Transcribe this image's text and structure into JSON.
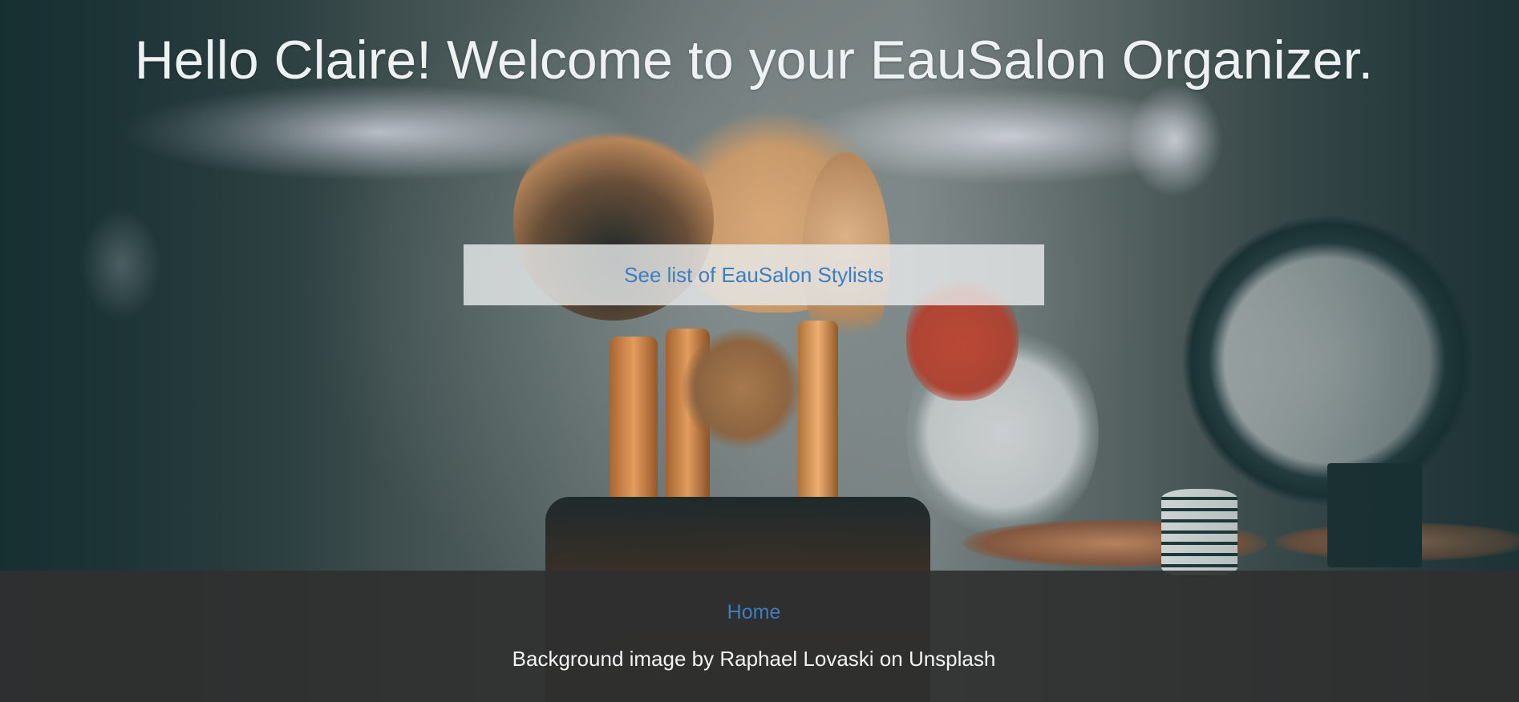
{
  "header": {
    "title": "Hello Claire! Welcome to your EauSalon Organizer."
  },
  "main": {
    "stylists_button_label": "See list of EauSalon Stylists"
  },
  "footer": {
    "home_link": "Home",
    "credit": "Background image by Raphael Lovaski on Unsplash"
  },
  "colors": {
    "link": "#3d7ec1",
    "title": "#eef1f1",
    "footer_bg": "#303030",
    "button_bg": "#e6e9e9"
  },
  "background": {
    "description_icon": "makeup-brushes-photo"
  }
}
